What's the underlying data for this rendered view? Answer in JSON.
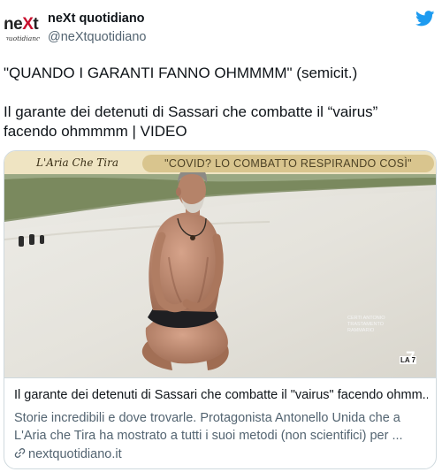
{
  "account": {
    "name": "neXt quotidiano",
    "handle": "@neXtquotidiano",
    "logo_main_pre": "ne",
    "logo_main_x": "X",
    "logo_main_post": "t",
    "logo_sub": "quotidiano"
  },
  "tweet": {
    "line1": "\"QUANDO I GARANTI FANNO OHMMMM\" (semicit.)",
    "line2": "Il garante dei detenuti di Sassari che combatte il “vairus” facendo ohmmmm | VIDEO"
  },
  "card": {
    "video_show_logo": "L'Aria Che Tira",
    "video_banner": "\"COVID? LO COMBATTO RESPIRANDO COSÌ\"",
    "video_side_caption": "CERTI ANTONIO TRASTAMENTO RAMMARIO",
    "channel_logo": "LA 7",
    "title": "Il garante dei detenuti di Sassari che combatte il \"vairus\" facendo ohmm...",
    "description": "Storie incredibili e dove trovarle. Protagonista Antonello Unida che a L'Aria che Tira ha mostrato a tutti i suoi metodi (non scientifici) per ...",
    "domain": "nextquotidiano.it"
  },
  "colors": {
    "twitter_blue": "#1d9bf0",
    "text_primary": "#0f1419",
    "text_secondary": "#536471",
    "border": "#cfd9de",
    "logo_red": "#c8102e"
  },
  "icons": {
    "platform": "twitter-bird-icon",
    "card_link": "link-icon"
  }
}
